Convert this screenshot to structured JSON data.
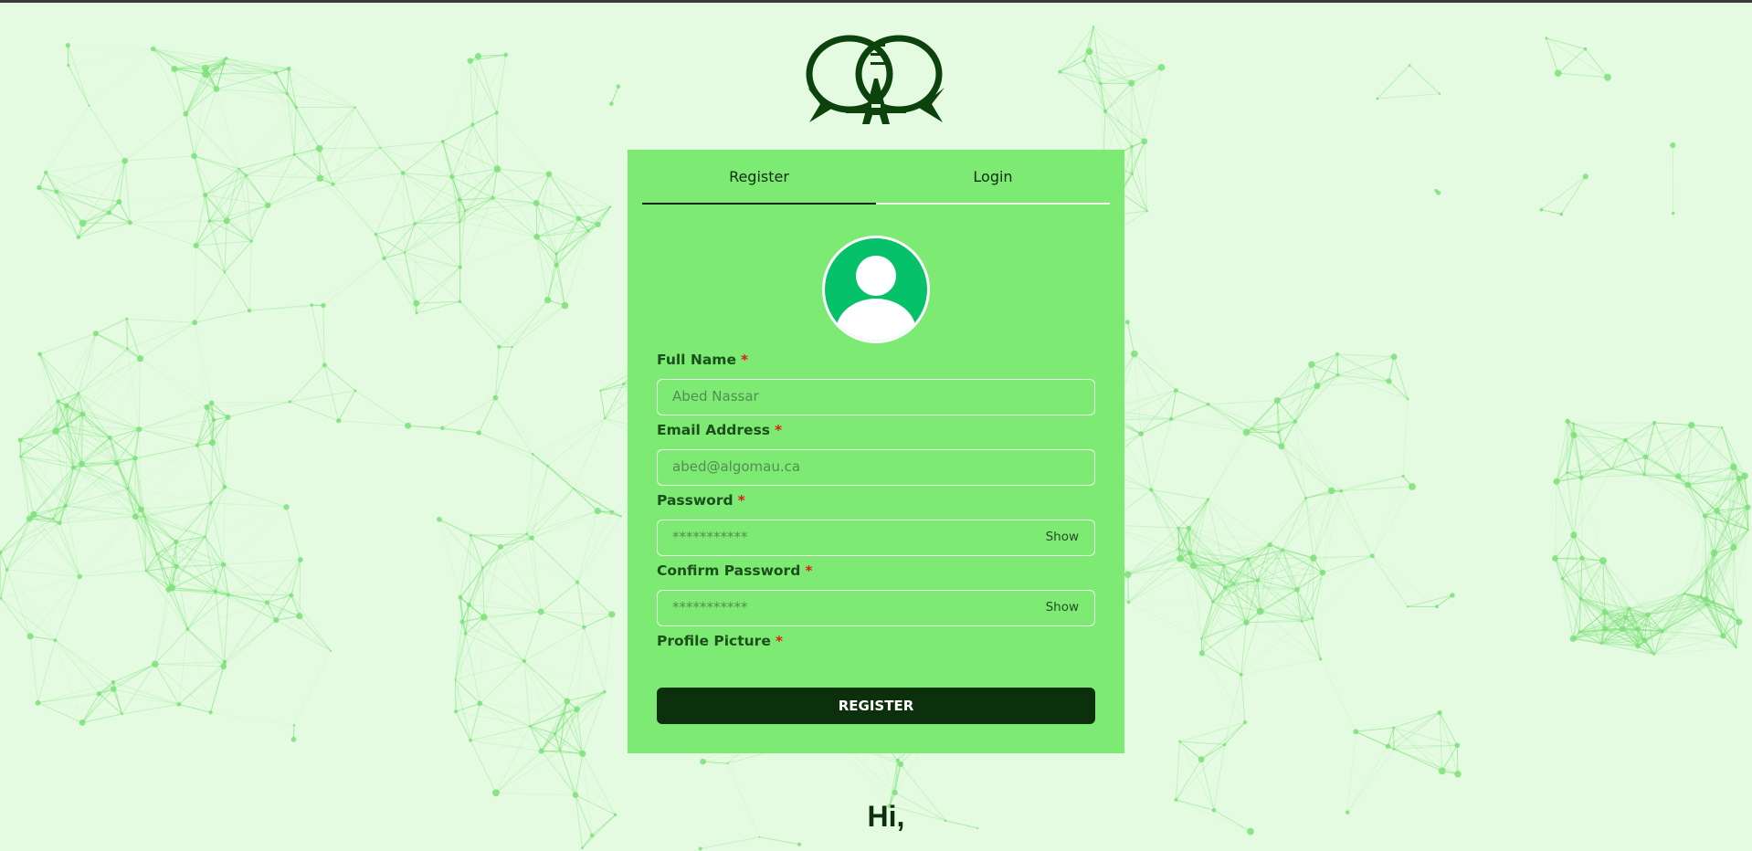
{
  "tabs": {
    "register": "Register",
    "login": "Login",
    "active": "register"
  },
  "form": {
    "full_name": {
      "label": "Full Name",
      "required": "*",
      "placeholder": "Abed Nassar"
    },
    "email": {
      "label": "Email Address",
      "required": "*",
      "placeholder": "abed@algomau.ca"
    },
    "password": {
      "label": "Password",
      "required": "*",
      "placeholder": "***********",
      "toggle": "Show"
    },
    "confirm_password": {
      "label": "Confirm Password",
      "required": "*",
      "placeholder": "***********",
      "toggle": "Show"
    },
    "profile_picture": {
      "label": "Profile Picture",
      "required": "*"
    },
    "submit": "REGISTER"
  },
  "greeting": "Hi,",
  "icons": {
    "logo": "chat-bubbles-logo-icon",
    "avatar": "user-avatar-icon"
  },
  "colors": {
    "background": "#e4fbe1",
    "card": "#7dea73",
    "accent_dark": "#0c2f0c",
    "avatar": "#05c16a",
    "network": "#7ee07a"
  }
}
